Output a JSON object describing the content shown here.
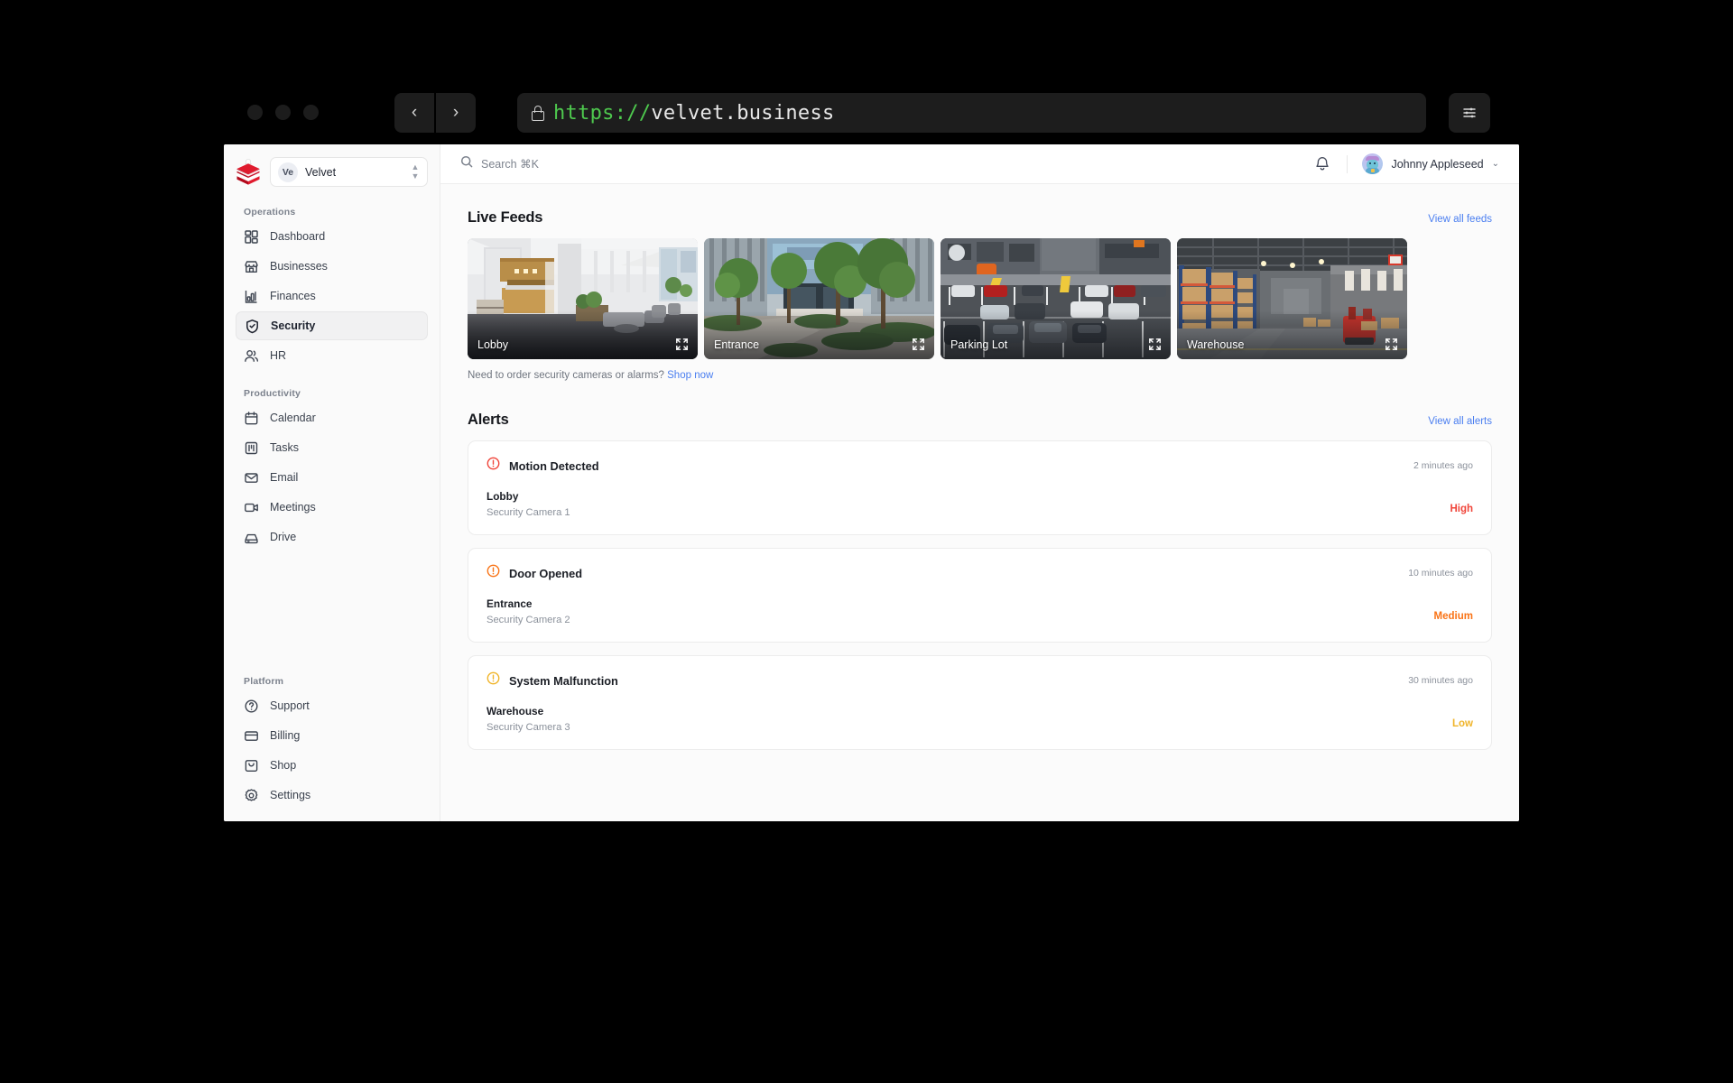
{
  "browser": {
    "url_scheme": "https://",
    "url_host": "velvet.business",
    "back_glyph": "‹",
    "forward_glyph": "›",
    "lock_icon": "lock-icon",
    "settings_icon": "browser-settings-icon"
  },
  "sidebar": {
    "workspace": {
      "badge": "Ve",
      "name": "Velvet",
      "logo_icon": "velvet-cake-logo"
    },
    "groups": [
      {
        "label": "Operations",
        "items": [
          {
            "label": "Dashboard",
            "icon": "grid-icon",
            "active": false
          },
          {
            "label": "Businesses",
            "icon": "store-icon",
            "active": false
          },
          {
            "label": "Finances",
            "icon": "bar-chart-icon",
            "active": false
          },
          {
            "label": "Security",
            "icon": "shield-check-icon",
            "active": true
          },
          {
            "label": "HR",
            "icon": "users-icon",
            "active": false
          }
        ]
      },
      {
        "label": "Productivity",
        "items": [
          {
            "label": "Calendar",
            "icon": "calendar-icon",
            "active": false
          },
          {
            "label": "Tasks",
            "icon": "tasks-icon",
            "active": false
          },
          {
            "label": "Email",
            "icon": "envelope-icon",
            "active": false
          },
          {
            "label": "Meetings",
            "icon": "video-camera-icon",
            "active": false
          },
          {
            "label": "Drive",
            "icon": "drive-icon",
            "active": false
          }
        ]
      },
      {
        "label": "Platform",
        "items": [
          {
            "label": "Support",
            "icon": "question-circle-icon",
            "active": false
          },
          {
            "label": "Billing",
            "icon": "credit-card-icon",
            "active": false
          },
          {
            "label": "Shop",
            "icon": "shopping-bag-icon",
            "active": false
          },
          {
            "label": "Settings",
            "icon": "gear-icon",
            "active": false
          }
        ]
      }
    ]
  },
  "topbar": {
    "search_label": "Search ⌘K",
    "search_icon": "search-icon",
    "bell_icon": "bell-icon",
    "user_name": "Johnny Appleseed",
    "caret_glyph": "⌄"
  },
  "live_feeds": {
    "title": "Live Feeds",
    "view_all": "View all feeds",
    "feeds": [
      {
        "label": "Lobby",
        "scene": "office-lobby-interior"
      },
      {
        "label": "Entrance",
        "scene": "building-entrance-courtyard"
      },
      {
        "label": "Parking Lot",
        "scene": "parking-lot-aerial"
      },
      {
        "label": "Warehouse",
        "scene": "warehouse-aisle"
      }
    ],
    "promo_text": "Need to order security cameras or alarms? ",
    "promo_link": "Shop now"
  },
  "alerts": {
    "title": "Alerts",
    "view_all": "View all alerts",
    "items": [
      {
        "type": "Motion Detected",
        "time": "2 minutes ago",
        "location": "Lobby",
        "camera": "Security Camera 1",
        "severity": "High",
        "severity_color": "#f0453a",
        "icon_color": "#f0453a"
      },
      {
        "type": "Door Opened",
        "time": "10 minutes ago",
        "location": "Entrance",
        "camera": "Security Camera 2",
        "severity": "Medium",
        "severity_color": "#f97316",
        "icon_color": "#f97316"
      },
      {
        "type": "System Malfunction",
        "time": "30 minutes ago",
        "location": "Warehouse",
        "camera": "Security Camera 3",
        "severity": "Low",
        "severity_color": "#f0b429",
        "icon_color": "#f0b429"
      }
    ]
  },
  "colors": {
    "accent_link": "#4a7ef0",
    "brand_red": "#e01b2e",
    "sidebar_bg": "#fafafa"
  }
}
